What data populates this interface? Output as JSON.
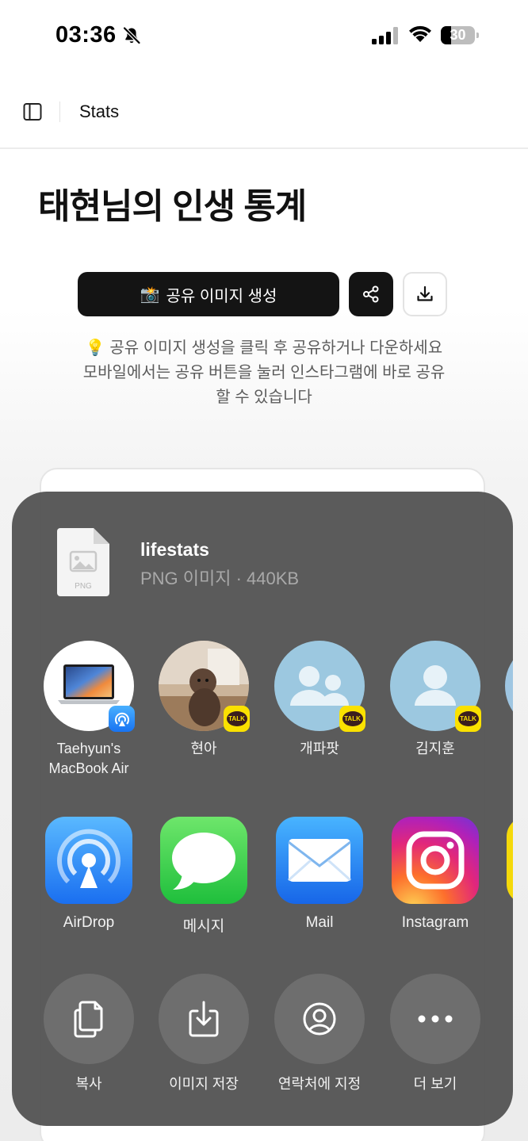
{
  "status_bar": {
    "time": "03:36",
    "battery": "30",
    "battery_level": 0.3
  },
  "header": {
    "title": "Stats"
  },
  "page": {
    "title": "태현님의 인생 통계",
    "generate_button": {
      "emoji": "📸",
      "label": "공유 이미지 생성"
    },
    "hint_line1": "💡 공유 이미지 생성을 클릭 후 공유하거나 다운하세요",
    "hint_line2": "모바일에서는 공유 버튼을 눌러 인스타그램에 바로 공유",
    "hint_line3": "할 수 있습니다"
  },
  "share_sheet": {
    "file": {
      "name": "lifestats",
      "meta": "PNG 이미지 · 440KB",
      "thumb_label": "PNG"
    },
    "people": [
      {
        "name_line1": "Taehyun's",
        "name_line2": "MacBook Air",
        "badge": "airdrop-icon"
      },
      {
        "name_line1": "현아",
        "name_line2": "",
        "badge": "kakaotalk-icon"
      },
      {
        "name_line1": "개파팟",
        "name_line2": "",
        "badge": "kakaotalk-icon"
      },
      {
        "name_line1": "김지훈",
        "name_line2": "",
        "badge": "kakaotalk-icon"
      }
    ],
    "talk_label": "TALK",
    "apps": [
      {
        "label": "AirDrop",
        "icon": "airdrop-icon"
      },
      {
        "label": "메시지",
        "icon": "messages-icon"
      },
      {
        "label": "Mail",
        "icon": "mail-icon"
      },
      {
        "label": "Instagram",
        "icon": "instagram-icon"
      }
    ],
    "actions": [
      {
        "label": "복사",
        "icon": "copy-icon"
      },
      {
        "label": "이미지 저장",
        "icon": "save-image-icon"
      },
      {
        "label": "연락처에 지정",
        "icon": "contact-icon"
      },
      {
        "label": "더 보기",
        "icon": "more-icon"
      }
    ]
  },
  "colors": {
    "primary_button": "#141414",
    "sheet_background": "#545454",
    "kakao_yellow": "#fae100",
    "contact_avatar": "#9cc8e0"
  }
}
